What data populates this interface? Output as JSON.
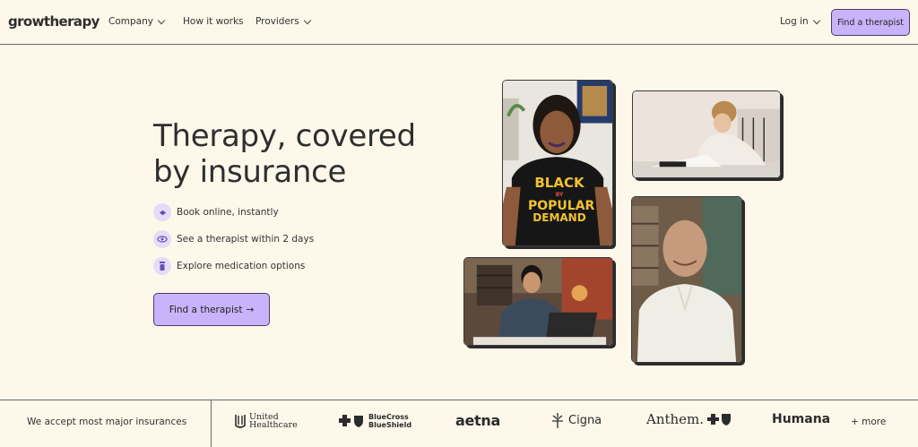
{
  "header": {
    "logo": "growtherapy",
    "nav": [
      {
        "label": "Company",
        "has_dropdown": true
      },
      {
        "label": "How it works",
        "has_dropdown": false
      },
      {
        "label": "Providers",
        "has_dropdown": true
      }
    ],
    "login_label": "Log in",
    "cta_label": "Find a therapist"
  },
  "hero": {
    "headline_line1": "Therapy, covered",
    "headline_line2": "by insurance",
    "features": [
      {
        "label": "Book online, instantly",
        "icon": "calendar-icon"
      },
      {
        "label": "See a therapist within 2 days",
        "icon": "eye-icon"
      },
      {
        "label": "Explore medication options",
        "icon": "pill-bottle-icon"
      }
    ],
    "cta_label": "Find a therapist",
    "cta_arrow": "→"
  },
  "photos": {
    "woman_shirt_text": [
      "BLACK",
      "BY",
      "POPULAR",
      "DEMAND"
    ]
  },
  "insurance": {
    "label": "We accept most major insurances",
    "providers": [
      {
        "line1": "United",
        "line2": "Healthcare"
      },
      {
        "line1": "BlueCross",
        "line2": "BlueShield"
      },
      {
        "name": "aetna"
      },
      {
        "name": "Cigna"
      },
      {
        "name": "Anthem."
      },
      {
        "name": "Humana"
      }
    ],
    "more_label": "+ more"
  },
  "colors": {
    "background": "#fdf8ea",
    "accent": "#c9b4fb",
    "text": "#2b2b2b"
  }
}
